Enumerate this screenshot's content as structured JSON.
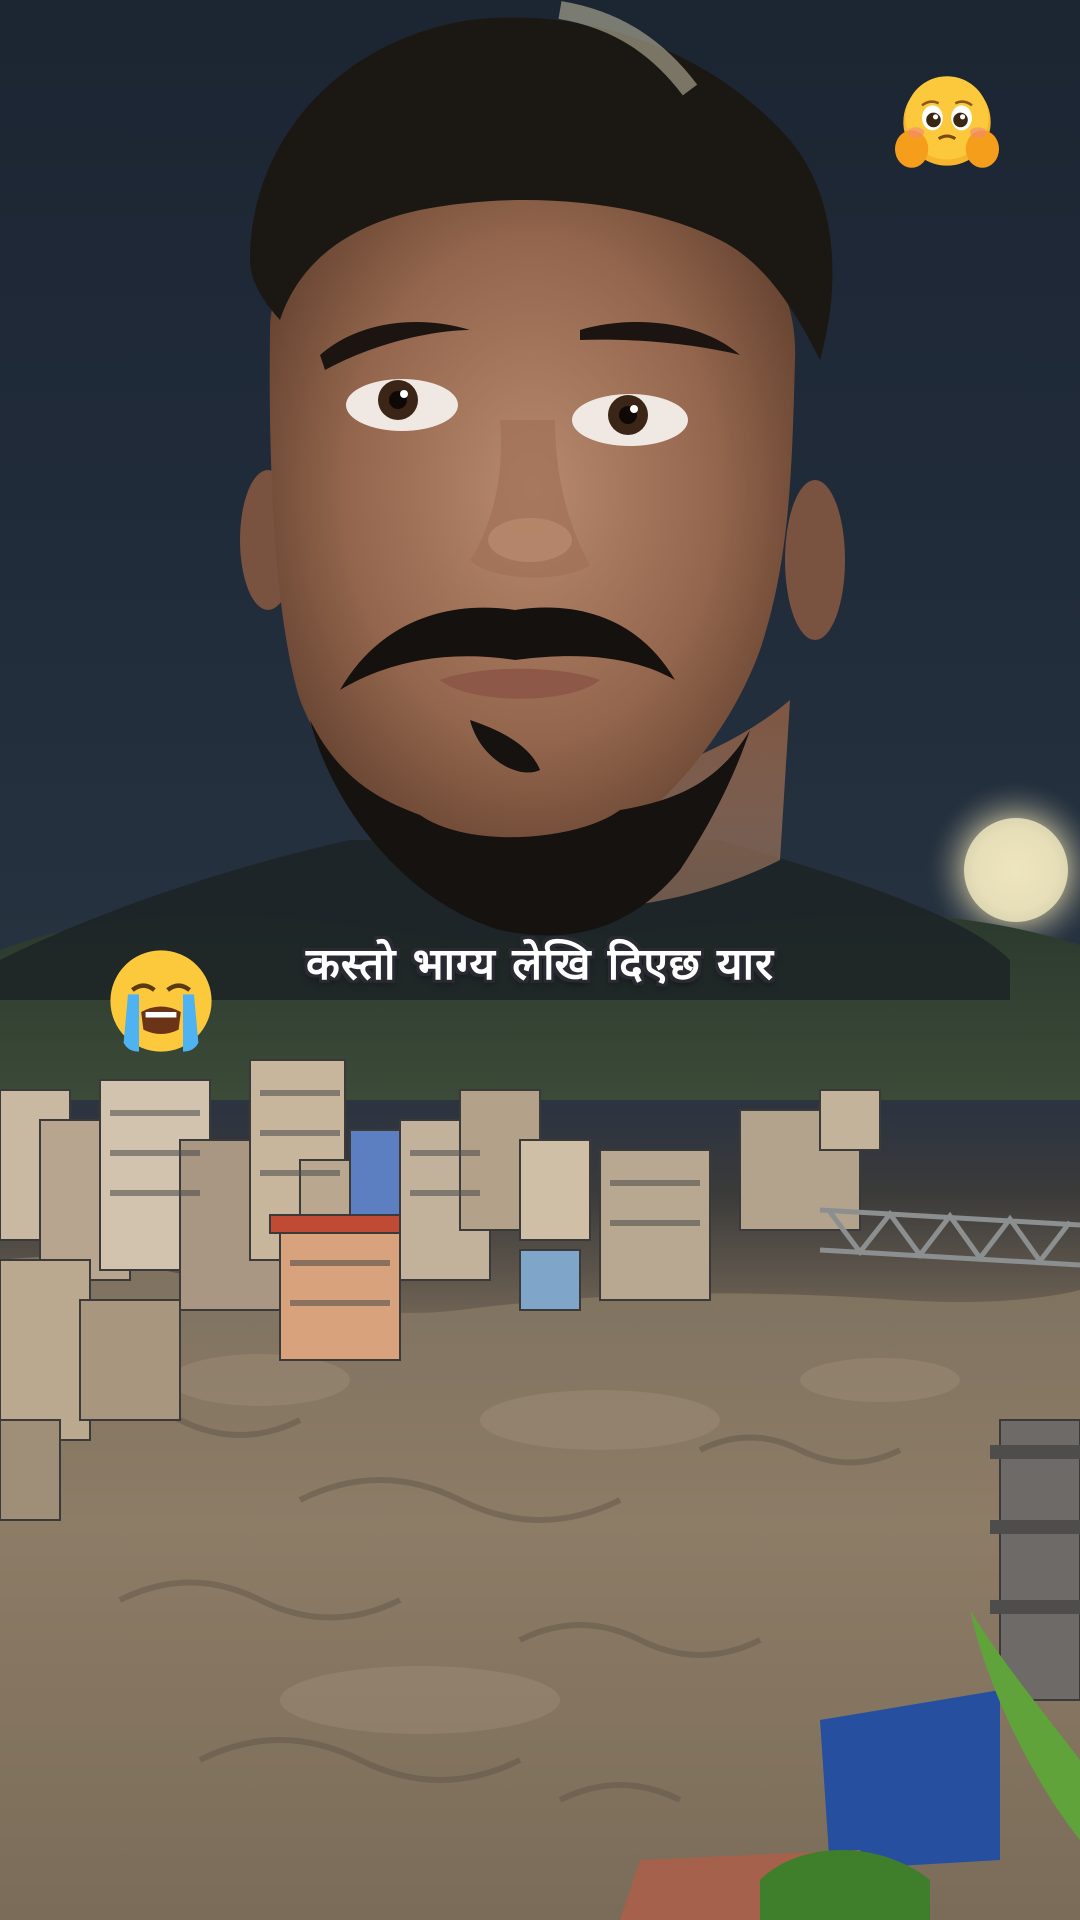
{
  "caption": "कस्तो भाग्य लेखि दिएछ यार",
  "emojis": {
    "top_right": "pleading-face-with-hands",
    "left": "loudly-crying-face"
  },
  "colors": {
    "night_sky": "#1f2937",
    "floodwater": "#8c7b66",
    "moon": "#e8e0b8",
    "caption_text": "#ffffff",
    "caption_outline": "#2a2a33",
    "emoji_yellow": "#f7b52e"
  }
}
